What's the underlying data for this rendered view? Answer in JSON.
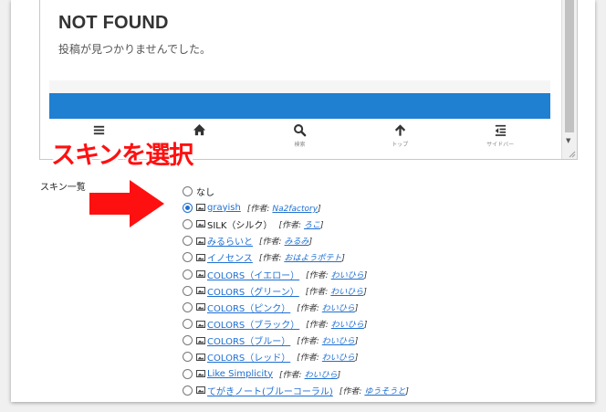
{
  "preview": {
    "title": "NOT FOUND",
    "message": "投稿が見つかりませんでした。",
    "nav": [
      {
        "icon": "menu-icon",
        "label": ""
      },
      {
        "icon": "home-icon",
        "label": ""
      },
      {
        "icon": "search-icon",
        "label": "検索"
      },
      {
        "icon": "arrow-up-icon",
        "label": "トップ"
      },
      {
        "icon": "sidebar-icon",
        "label": "サイドバー"
      }
    ],
    "accent_color": "#1f7fd1"
  },
  "annotation": {
    "text": "スキンを選択",
    "color": "#ff1010"
  },
  "skins": {
    "section_label": "スキン一覧",
    "author_prefix": "[作者:",
    "author_suffix": "]",
    "items": [
      {
        "name": "なし",
        "author": "",
        "link": false,
        "checked": false,
        "has_icon": false
      },
      {
        "name": "grayish",
        "author": "Na2factory",
        "link": true,
        "checked": true,
        "has_icon": true
      },
      {
        "name": "SILK（シルク）",
        "author": "ろこ",
        "link": false,
        "checked": false,
        "has_icon": true
      },
      {
        "name": "みるらいと",
        "author": "みるみ",
        "link": true,
        "checked": false,
        "has_icon": true
      },
      {
        "name": "イノセンス",
        "author": "おはようポテト",
        "link": true,
        "checked": false,
        "has_icon": true
      },
      {
        "name": "COLORS（イエロー）",
        "author": "わいひら",
        "link": true,
        "checked": false,
        "has_icon": true
      },
      {
        "name": "COLORS（グリーン）",
        "author": "わいひら",
        "link": true,
        "checked": false,
        "has_icon": true
      },
      {
        "name": "COLORS（ピンク）",
        "author": "わいひら",
        "link": true,
        "checked": false,
        "has_icon": true
      },
      {
        "name": "COLORS（ブラック）",
        "author": "わいひら",
        "link": true,
        "checked": false,
        "has_icon": true
      },
      {
        "name": "COLORS（ブルー）",
        "author": "わいひら",
        "link": true,
        "checked": false,
        "has_icon": true
      },
      {
        "name": "COLORS（レッド）",
        "author": "わいひら",
        "link": true,
        "checked": false,
        "has_icon": true
      },
      {
        "name": "Like Simplicity",
        "author": "わいひら",
        "link": true,
        "checked": false,
        "has_icon": true
      },
      {
        "name": "てがきノート(ブルーコーラル)",
        "author": "ゆうそうと",
        "link": true,
        "checked": false,
        "has_icon": true
      }
    ]
  }
}
